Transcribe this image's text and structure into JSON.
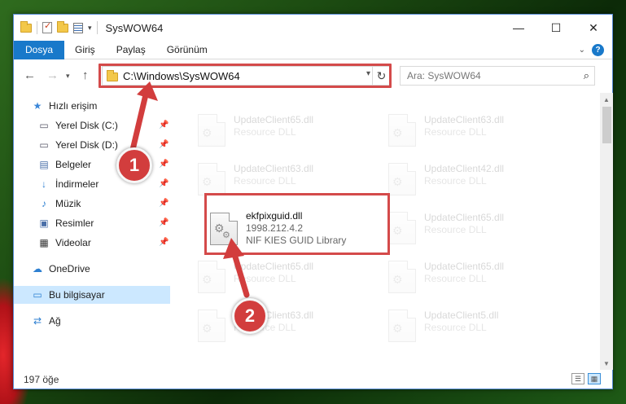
{
  "window": {
    "title": "SysWOW64",
    "controls": {
      "minimize": "—",
      "maximize": "☐",
      "close": "✕"
    }
  },
  "ribbon": {
    "tabs": [
      "Dosya",
      "Giriş",
      "Paylaş",
      "Görünüm"
    ],
    "help": "?"
  },
  "address": {
    "path": "C:\\Windows\\SysWOW64",
    "search_placeholder": "Ara: SysWOW64"
  },
  "sidebar": {
    "items": [
      {
        "label": "Hızlı erişim",
        "icon": "star-icon"
      },
      {
        "label": "Yerel Disk (C:)",
        "icon": "drive-icon",
        "pinned": true
      },
      {
        "label": "Yerel Disk (D:)",
        "icon": "drive-icon",
        "pinned": true
      },
      {
        "label": "Belgeler",
        "icon": "documents-icon",
        "pinned": true
      },
      {
        "label": "İndirmeler",
        "icon": "download-icon",
        "pinned": true
      },
      {
        "label": "Müzik",
        "icon": "music-icon",
        "pinned": true
      },
      {
        "label": "Resimler",
        "icon": "pictures-icon",
        "pinned": true
      },
      {
        "label": "Videolar",
        "icon": "video-icon",
        "pinned": true
      },
      {
        "label": "OneDrive",
        "icon": "cloud-icon"
      },
      {
        "label": "Bu bilgisayar",
        "icon": "computer-icon",
        "selected": true
      },
      {
        "label": "Ağ",
        "icon": "network-icon"
      }
    ]
  },
  "files": [
    {
      "name": "UpdateClient65.dll",
      "desc": "Resource DLL"
    },
    {
      "name": "UpdateClient63.dll",
      "desc": "Resource DLL"
    },
    {
      "name": "UpdateClient63.dll",
      "desc": "Resource DLL"
    },
    {
      "name": "UpdateClient42.dll",
      "desc": "Resource DLL"
    },
    {
      "name": "ekfpixguid.dll",
      "version": "1998.212.4.2",
      "desc": "NIF KIES GUID Library",
      "highlighted": true
    },
    {
      "name": "UpdateClient65.dll",
      "desc": "Resource DLL"
    },
    {
      "name": "UpdateClient65.dll",
      "desc": "Resource DLL"
    },
    {
      "name": "UpdateClient65.dll",
      "desc": "Resource DLL"
    },
    {
      "name": "UpdateClient63.dll",
      "desc": "Resource DLL"
    },
    {
      "name": "UpdateClient5.dll",
      "desc": "Resource DLL"
    }
  ],
  "status": {
    "count": "197 öğe"
  },
  "annotations": {
    "step1": "1",
    "step2": "2",
    "color": "#d23d3d"
  }
}
